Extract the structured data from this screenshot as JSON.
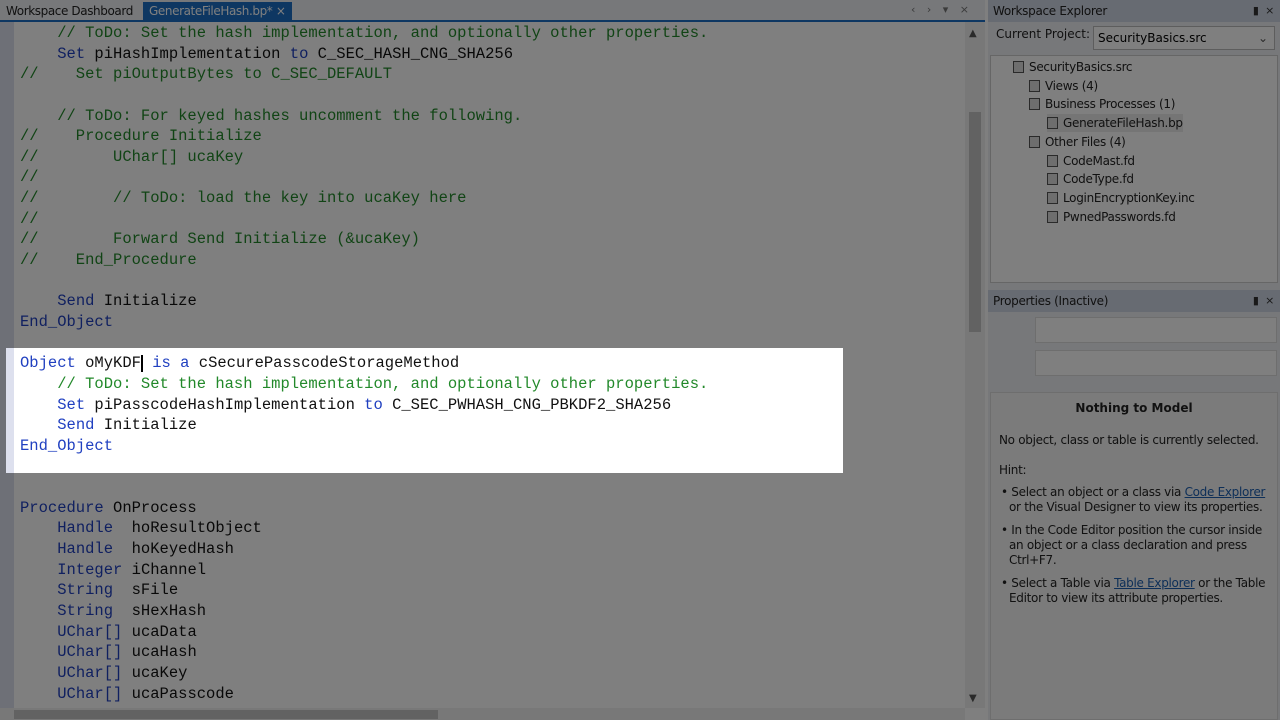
{
  "tabs": [
    {
      "label": "Workspace Dashboard",
      "active": false
    },
    {
      "label": "GenerateFileHash.bp*",
      "active": true,
      "close": "×"
    }
  ],
  "tab_nav": "‹ › ▾ ×",
  "code": [
    [
      [
        "cm",
        "    // ToDo: Set the hash implementation, and optionally other properties."
      ]
    ],
    [
      [
        "tx",
        "    "
      ],
      [
        "kw",
        "Set"
      ],
      [
        "tx",
        " piHashImplementation "
      ],
      [
        "kw",
        "to"
      ],
      [
        "tx",
        " C_SEC_HASH_CNG_SHA256"
      ]
    ],
    [
      [
        "cm",
        "//    Set piOutputBytes to C_SEC_DEFAULT"
      ]
    ],
    [],
    [
      [
        "cm",
        "    // ToDo: For keyed hashes uncomment the following."
      ]
    ],
    [
      [
        "cm",
        "//    Procedure Initialize"
      ]
    ],
    [
      [
        "cm",
        "//        UChar[] ucaKey"
      ]
    ],
    [
      [
        "cm",
        "//"
      ]
    ],
    [
      [
        "cm",
        "//        // ToDo: load the key into ucaKey here"
      ]
    ],
    [
      [
        "cm",
        "//"
      ]
    ],
    [
      [
        "cm",
        "//        Forward Send Initialize (&ucaKey)"
      ]
    ],
    [
      [
        "cm",
        "//    End_Procedure"
      ]
    ],
    [],
    [
      [
        "tx",
        "    "
      ],
      [
        "kw",
        "Send"
      ],
      [
        "tx",
        " Initialize"
      ]
    ],
    [
      [
        "kw",
        "End_Object"
      ]
    ],
    [],
    [
      [
        "kw",
        "Object"
      ],
      [
        "tx",
        " oMyKDF"
      ],
      [
        "caret",
        ""
      ],
      [
        "tx",
        " "
      ],
      [
        "kw",
        "is a"
      ],
      [
        "tx",
        " cSecurePasscodeStorageMethod"
      ]
    ],
    [
      [
        "cm",
        "    // ToDo: Set the hash implementation, and optionally other properties."
      ]
    ],
    [
      [
        "tx",
        "    "
      ],
      [
        "kw",
        "Set"
      ],
      [
        "tx",
        " piPasscodeHashImplementation "
      ],
      [
        "kw",
        "to"
      ],
      [
        "tx",
        " C_SEC_PWHASH_CNG_PBKDF2_SHA256"
      ]
    ],
    [
      [
        "tx",
        "    "
      ],
      [
        "kw",
        "Send"
      ],
      [
        "tx",
        " Initialize"
      ]
    ],
    [
      [
        "kw",
        "End_Object"
      ]
    ],
    [],
    [],
    [
      [
        "kw",
        "Procedure"
      ],
      [
        "tx",
        " OnProcess"
      ]
    ],
    [
      [
        "tx",
        "    "
      ],
      [
        "kw",
        "Handle"
      ],
      [
        "tx",
        "  hoResultObject"
      ]
    ],
    [
      [
        "tx",
        "    "
      ],
      [
        "kw",
        "Handle"
      ],
      [
        "tx",
        "  hoKeyedHash"
      ]
    ],
    [
      [
        "tx",
        "    "
      ],
      [
        "kw",
        "Integer"
      ],
      [
        "tx",
        " iChannel"
      ]
    ],
    [
      [
        "tx",
        "    "
      ],
      [
        "kw",
        "String"
      ],
      [
        "tx",
        "  sFile"
      ]
    ],
    [
      [
        "tx",
        "    "
      ],
      [
        "kw",
        "String"
      ],
      [
        "tx",
        "  sHexHash"
      ]
    ],
    [
      [
        "tx",
        "    "
      ],
      [
        "kw",
        "UChar[]"
      ],
      [
        "tx",
        " ucaData"
      ]
    ],
    [
      [
        "tx",
        "    "
      ],
      [
        "kw",
        "UChar[]"
      ],
      [
        "tx",
        " ucaHash"
      ]
    ],
    [
      [
        "tx",
        "    "
      ],
      [
        "kw",
        "UChar[]"
      ],
      [
        "tx",
        " ucaKey"
      ]
    ],
    [
      [
        "tx",
        "    "
      ],
      [
        "kw",
        "UChar[]"
      ],
      [
        "tx",
        " ucaPasscode"
      ]
    ]
  ],
  "workspace": {
    "title": "Workspace Explorer",
    "pin": "▮",
    "close": "×",
    "current_project_label": "Current Project:",
    "current_project": "SecurityBasics.src",
    "tree": [
      {
        "label": "SecurityBasics.src",
        "level": 0,
        "icon": "project-icon"
      },
      {
        "label": "Views (4)",
        "level": 1,
        "icon": "views-icon"
      },
      {
        "label": "Business Processes (1)",
        "level": 1,
        "icon": "business-process-icon"
      },
      {
        "label": "GenerateFileHash.bp",
        "level": 2,
        "icon": "file-icon",
        "selected": true
      },
      {
        "label": "Other Files (4)",
        "level": 1,
        "icon": "other-files-icon"
      },
      {
        "label": "CodeMast.fd",
        "level": 2,
        "icon": "file-icon"
      },
      {
        "label": "CodeType.fd",
        "level": 2,
        "icon": "file-icon"
      },
      {
        "label": "LoginEncryptionKey.inc",
        "level": 2,
        "icon": "file-icon"
      },
      {
        "label": "PwnedPasswords.fd",
        "level": 2,
        "icon": "file-icon"
      }
    ]
  },
  "properties": {
    "title": "Properties (Inactive)",
    "pin": "▮",
    "close": "×",
    "heading": "Nothing to Model",
    "message": "No object, class or table is currently selected.",
    "hint": "Hint:",
    "bullets": [
      {
        "pre": "Select an object or a class via ",
        "link": "Code Explorer",
        "post": " or the Visual Designer to view its properties."
      },
      {
        "pre": "In the Code Editor position the cursor inside an object or a class declaration and press Ctrl+F7.",
        "link": "",
        "post": ""
      },
      {
        "pre": "Select a Table via ",
        "link": "Table Explorer",
        "post": " or the Table Editor to view its attribute properties."
      }
    ]
  },
  "colors": {
    "keyword": "#2040c0",
    "comment": "#22892a",
    "accent": "#1c6fc4"
  }
}
